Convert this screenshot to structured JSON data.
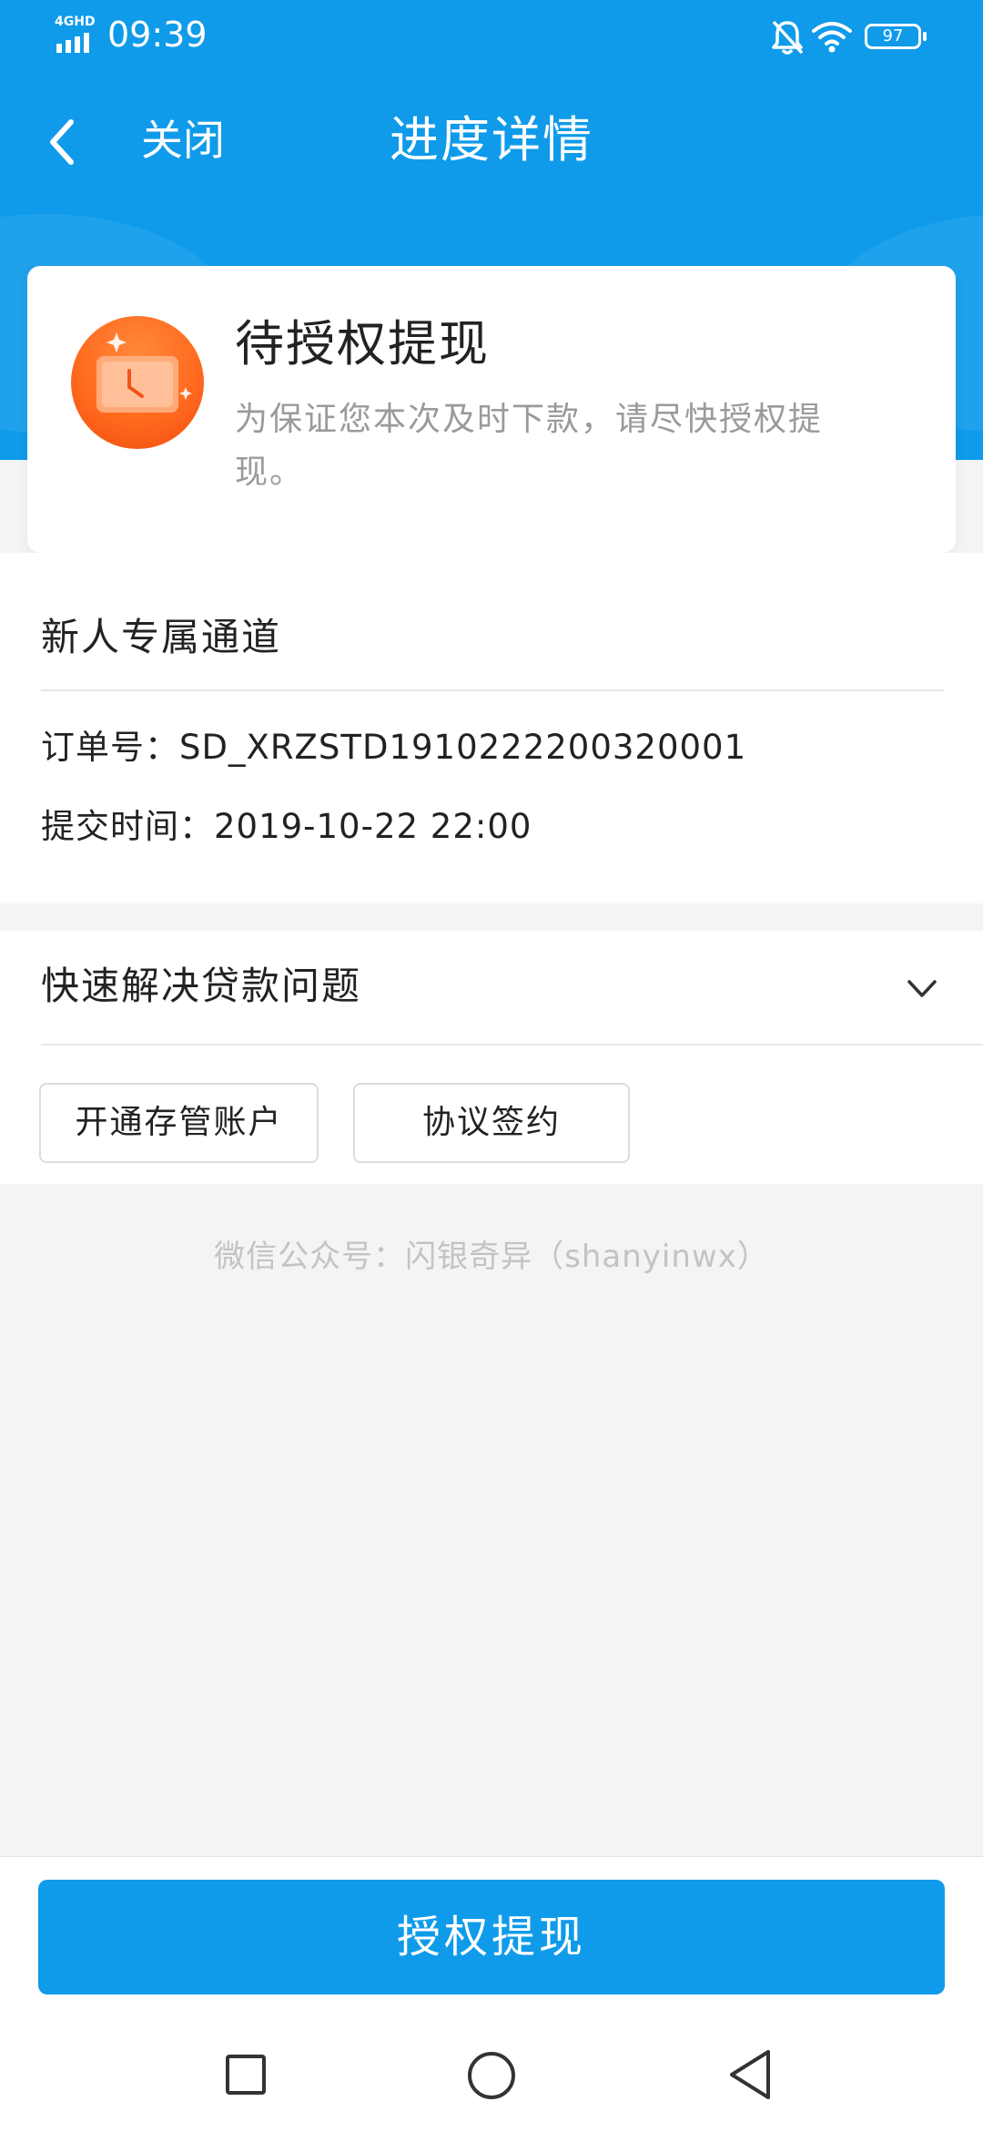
{
  "status_bar": {
    "network": "4GHD",
    "time": "09:39",
    "battery": "97",
    "icons": [
      "signal-icon",
      "mute-bell-icon",
      "wifi-icon",
      "battery-icon"
    ]
  },
  "nav": {
    "close_label": "关闭",
    "title": "进度详情",
    "back_icon": "chevron-left-icon"
  },
  "status_card": {
    "icon": "clock-card-icon",
    "title": "待授权提现",
    "description": "为保证您本次及时下款，请尽快授权提现。"
  },
  "order": {
    "channel": "新人专属通道",
    "order_no_label": "订单号：",
    "order_no": "SD_XRZSTD1910222200320001",
    "submit_time_label": "提交时间：",
    "submit_time": "2019-10-22 22:00"
  },
  "help": {
    "title": "快速解决贷款问题",
    "toggle_icon": "chevron-down-icon",
    "tags": [
      "开通存管账户",
      "协议签约"
    ]
  },
  "footer_note": "微信公众号：闪银奇异（shanyinwx）",
  "actions": {
    "primary_label": "授权提现"
  },
  "system_nav": {
    "icons": [
      "recent-apps-icon",
      "home-icon",
      "back-triangle-icon"
    ]
  },
  "colors": {
    "brand": "#0f9bea",
    "status_icon": "#ff6a1f",
    "muted_text": "#9a9a9a",
    "page_bg": "#f4f4f4"
  }
}
